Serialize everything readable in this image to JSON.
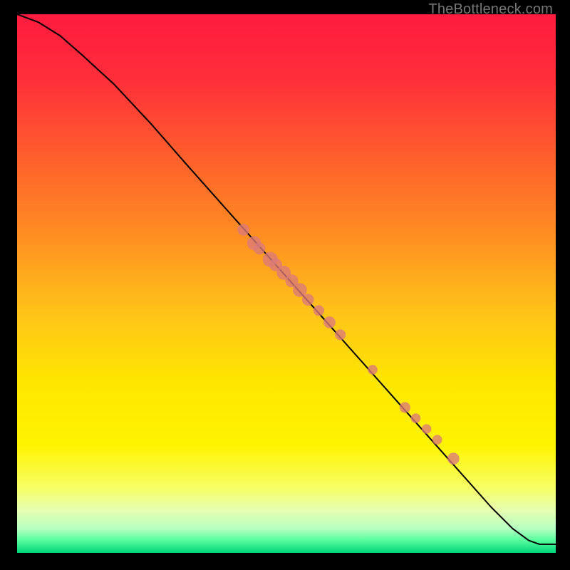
{
  "watermark": "TheBottleneck.com",
  "colors": {
    "dot": "#db7a7a",
    "curve": "#000000",
    "gradient_stops": [
      {
        "offset": 0.0,
        "color": "#ff1b3f"
      },
      {
        "offset": 0.12,
        "color": "#ff2e3a"
      },
      {
        "offset": 0.25,
        "color": "#ff5a2e"
      },
      {
        "offset": 0.4,
        "color": "#ff8a22"
      },
      {
        "offset": 0.55,
        "color": "#ffc21a"
      },
      {
        "offset": 0.68,
        "color": "#ffe600"
      },
      {
        "offset": 0.8,
        "color": "#fff400"
      },
      {
        "offset": 0.88,
        "color": "#f6ff66"
      },
      {
        "offset": 0.92,
        "color": "#e6ffb0"
      },
      {
        "offset": 0.955,
        "color": "#b6ffc2"
      },
      {
        "offset": 0.975,
        "color": "#5effa0"
      },
      {
        "offset": 1.0,
        "color": "#00d47a"
      }
    ]
  },
  "chart_data": {
    "type": "line",
    "title": "",
    "xlabel": "",
    "ylabel": "",
    "xlim": [
      0,
      100
    ],
    "ylim": [
      0,
      100
    ],
    "grid": false,
    "legend": false,
    "series": [
      {
        "name": "curve",
        "x": [
          0,
          4,
          8,
          12,
          18,
          25,
          32,
          40,
          48,
          56,
          64,
          72,
          80,
          88,
          92,
          95,
          97,
          100
        ],
        "y": [
          100,
          98.5,
          96,
          92.5,
          87,
          79.5,
          71.5,
          62.5,
          53.5,
          44.5,
          35.5,
          26.5,
          17.5,
          8.5,
          4.5,
          2.3,
          1.6,
          1.6
        ]
      }
    ],
    "scatter": {
      "name": "dots",
      "points": [
        {
          "x": 42,
          "y": 60,
          "r": 1.1
        },
        {
          "x": 44,
          "y": 57.5,
          "r": 1.3
        },
        {
          "x": 45,
          "y": 56.5,
          "r": 1.1
        },
        {
          "x": 47,
          "y": 54.5,
          "r": 1.4
        },
        {
          "x": 48,
          "y": 53.5,
          "r": 1.2
        },
        {
          "x": 49.5,
          "y": 52,
          "r": 1.3
        },
        {
          "x": 51,
          "y": 50.5,
          "r": 1.2
        },
        {
          "x": 52.5,
          "y": 48.8,
          "r": 1.3
        },
        {
          "x": 54,
          "y": 47,
          "r": 1.1
        },
        {
          "x": 56,
          "y": 45,
          "r": 1.0
        },
        {
          "x": 58,
          "y": 42.8,
          "r": 1.1
        },
        {
          "x": 60,
          "y": 40.5,
          "r": 1.0
        },
        {
          "x": 66,
          "y": 34,
          "r": 0.9
        },
        {
          "x": 72,
          "y": 27,
          "r": 1.0
        },
        {
          "x": 74,
          "y": 25,
          "r": 0.9
        },
        {
          "x": 76,
          "y": 23,
          "r": 0.9
        },
        {
          "x": 78,
          "y": 21,
          "r": 0.9
        },
        {
          "x": 81,
          "y": 17.5,
          "r": 1.1
        }
      ]
    }
  }
}
